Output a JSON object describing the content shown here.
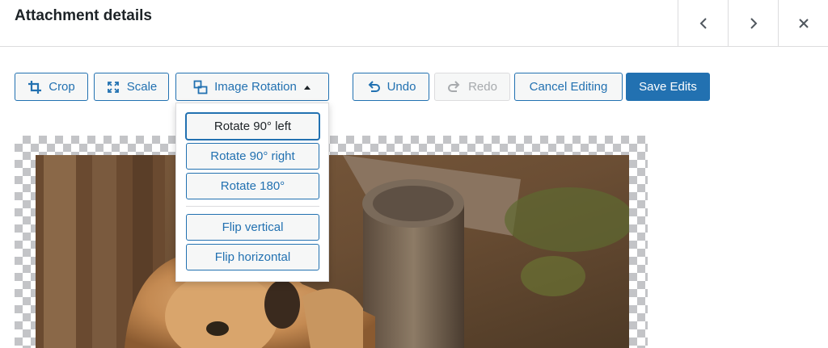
{
  "header": {
    "title": "Attachment details",
    "prev_icon": "chevron-left-icon",
    "next_icon": "chevron-right-icon",
    "close_icon": "close-icon"
  },
  "toolbar": {
    "crop_label": "Crop",
    "scale_label": "Scale",
    "rotation_label": "Image Rotation",
    "undo_label": "Undo",
    "redo_label": "Redo",
    "cancel_label": "Cancel Editing",
    "save_label": "Save Edits",
    "redo_disabled": true
  },
  "rotation_menu": {
    "expanded": true,
    "items": [
      "Rotate 90° left",
      "Rotate 90° right",
      "Rotate 180°",
      "Flip vertical",
      "Flip horizontal"
    ],
    "focused_item": "Rotate 90° left"
  },
  "colors": {
    "accent": "#2271b1",
    "primary_text": "#ffffff",
    "disabled_text": "#a7aaad",
    "border": "#dcdcde"
  }
}
